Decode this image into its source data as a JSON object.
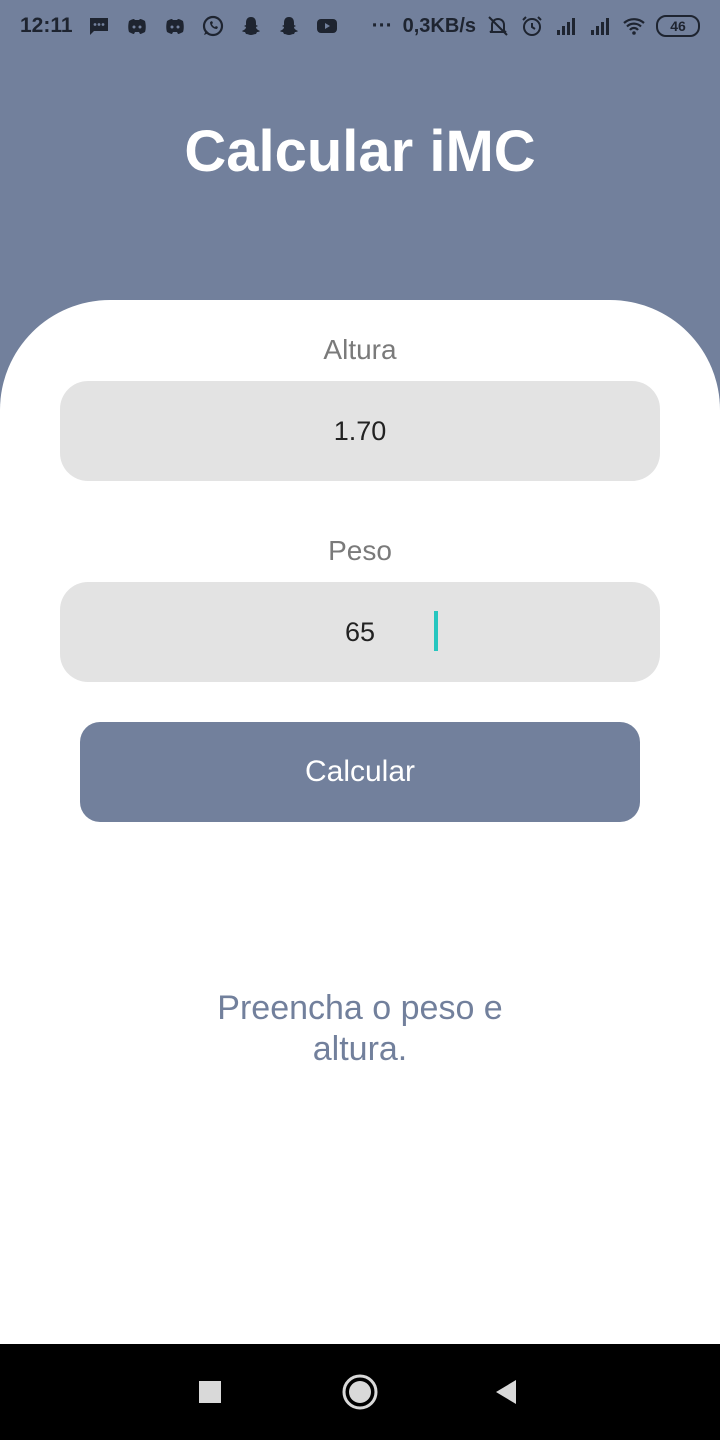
{
  "status_bar": {
    "time": "12:11",
    "left_icons": [
      "message-icon",
      "discord-icon",
      "discord-icon",
      "whatsapp-icon",
      "snapchat-icon",
      "snapchat-icon",
      "youtube-icon"
    ],
    "more": "···",
    "net_speed": "0,3KB/s",
    "right_icons": [
      "bell-off-icon",
      "alarm-icon",
      "signal-icon",
      "signal-icon",
      "wifi-icon"
    ],
    "battery": "46"
  },
  "app": {
    "title": "Calcular iMC"
  },
  "form": {
    "height_label": "Altura",
    "height_value": "1.70",
    "weight_label": "Peso",
    "weight_value": "65",
    "button_label": "Calcular"
  },
  "result": {
    "message": "Preencha o peso e altura."
  },
  "colors": {
    "primary": "#72809c",
    "field_bg": "#e3e3e3",
    "caret": "#26c6bf"
  },
  "nav_bar": {
    "icons": [
      "recents-icon",
      "home-icon",
      "back-icon"
    ]
  }
}
